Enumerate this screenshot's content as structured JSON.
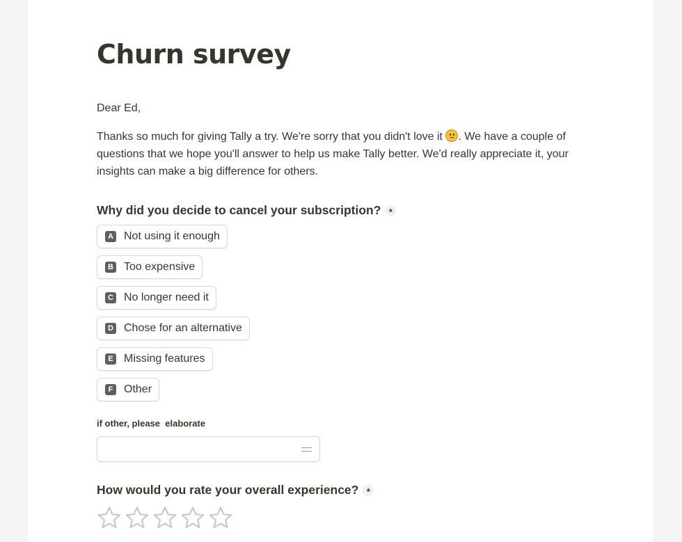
{
  "form": {
    "title": "Churn survey",
    "greeting": "Dear Ed,",
    "intro_before_emoji": "Thanks so much for giving Tally a try. We're sorry that you didn't love it ",
    "intro_after_emoji": ". We have a couple of questions that we hope you'll answer to help us make Tally better. We'd really appreciate it, your insights can make a big difference for others.",
    "intro_emoji": "sad-face-emoji"
  },
  "question1": {
    "label": "Why did you decide to cancel your subscription?",
    "required_mark": "*",
    "options": [
      {
        "key": "A",
        "label": "Not using it enough"
      },
      {
        "key": "B",
        "label": "Too expensive"
      },
      {
        "key": "C",
        "label": "No longer need it"
      },
      {
        "key": "D",
        "label": "Chose for an alternative"
      },
      {
        "key": "E",
        "label": "Missing features"
      },
      {
        "key": "F",
        "label": "Other"
      }
    ]
  },
  "other_field": {
    "label": "if other, please  elaborate",
    "value": "",
    "placeholder": ""
  },
  "question2": {
    "label": "How would you rate your overall experience?",
    "required_mark": "*",
    "rating_max": 5,
    "rating_value": 0
  },
  "colors": {
    "text": "#37352f",
    "key_badge": "#5f5e5b",
    "star_outline": "#c4c9d4",
    "border": "#d6d6d4"
  }
}
